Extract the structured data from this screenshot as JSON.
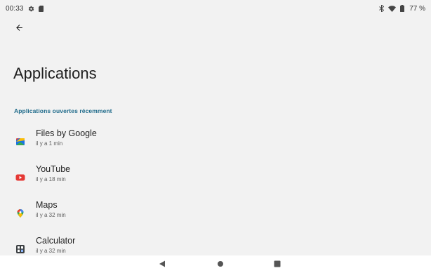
{
  "status_bar": {
    "time": "00:33",
    "battery": "77 %",
    "icons": [
      "settings-gear-icon",
      "sd-card-icon",
      "bluetooth-icon",
      "wifi-icon",
      "battery-icon"
    ]
  },
  "header": {
    "back_icon": "arrow-back-icon",
    "title": "Applications"
  },
  "recent_apps": {
    "section_label": "Applications ouvertes récemment",
    "items": [
      {
        "name": "Files by Google",
        "time": "il y a 1 min",
        "icon": "files-by-google-icon",
        "color": "#1a73e8"
      },
      {
        "name": "YouTube",
        "time": "il y a 18 min",
        "icon": "youtube-icon",
        "color": "#e53935"
      },
      {
        "name": "Maps",
        "time": "il y a 32 min",
        "icon": "maps-icon",
        "color": "#34a853"
      },
      {
        "name": "Calculator",
        "time": "il y a 32 min",
        "icon": "calculator-icon",
        "color": "#3c4043"
      }
    ]
  },
  "nav_bar": {
    "icons": [
      "nav-back-icon",
      "nav-home-icon",
      "nav-recents-icon"
    ]
  },
  "colors": {
    "background": "#f2f2f2",
    "accent": "#1e6a8a"
  }
}
